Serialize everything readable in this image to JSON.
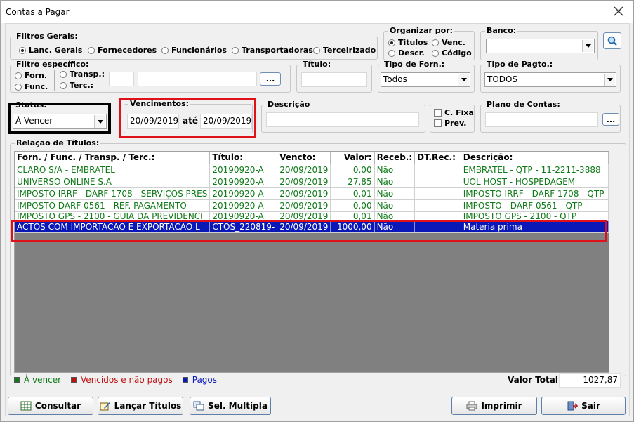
{
  "window": {
    "title": "Contas a Pagar"
  },
  "filtros_gerais": {
    "legend": "Filtros Gerais:",
    "options": [
      "Lanc. Gerais",
      "Fornecedores",
      "Funcionários",
      "Transportadoras",
      "Terceirizado"
    ],
    "selected": "Lanc. Gerais"
  },
  "organizar": {
    "legend": "Organizar por:",
    "options": [
      "Titulos",
      "Venc.",
      "Descr.",
      "Código"
    ],
    "selected": "Titulos"
  },
  "banco": {
    "legend": "Banco:",
    "value": ""
  },
  "filtro_especifico": {
    "legend": "Filtro específico:",
    "options": [
      "Forn.",
      "Func.",
      "Transp.:",
      "Terc.:"
    ],
    "code_value": "",
    "name_value": "",
    "browse_label": "..."
  },
  "titulo": {
    "legend": "Título:",
    "value": ""
  },
  "tipo_forn": {
    "legend": "Tipo de Forn.:",
    "value": "Todos"
  },
  "tipo_pagto": {
    "legend": "Tipo de Pagto.:",
    "value": "TODOS"
  },
  "status": {
    "legend": "Status:",
    "value": "À Vencer"
  },
  "vencimentos": {
    "legend": "Vencimentos:",
    "from": "20/09/2019",
    "sep": "até",
    "to": "20/09/2019"
  },
  "descricao": {
    "legend": "Descrição",
    "value": ""
  },
  "checks": {
    "c_fixa": "C. Fixa",
    "prev": "Prev."
  },
  "plano_contas": {
    "legend": "Plano de Contas:",
    "value": "",
    "browse_label": "..."
  },
  "relacao": {
    "legend": "Relação de Títulos:",
    "columns": [
      "Forn. / Func. / Transp. / Terc.:",
      "Título:",
      "Vencto:",
      "Valor:",
      "Receb.:",
      "DT.Rec.:",
      "Descrição:"
    ],
    "rows": [
      [
        "CLARO S/A - EMBRATEL",
        "20190920-A",
        "20/09/2019",
        "0,00",
        "Não",
        "",
        "EMBRATEL - QTP - 11-2211-3888"
      ],
      [
        "UNIVERSO ONLINE S.A",
        "20190920-A",
        "20/09/2019",
        "27,85",
        "Não",
        "",
        "UOL HOST - HOSPEDAGEM"
      ],
      [
        "IMPOSTO IRRF - DARF 1708 - SERVIÇOS PRES",
        "20190920-A",
        "20/09/2019",
        "0,01",
        "Não",
        "",
        "IMPOSTO IRRF - DARF 1708 - QTP"
      ],
      [
        "IMPOSTO DARF 0561 - REF. PAGAMENTO",
        "20190920-A",
        "20/09/2019",
        "0,00",
        "Não",
        "",
        "IMPOSTO - DARF 0561 - QTP"
      ],
      [
        "IMPOSTO GPS - 2100 - GUIA DA PREVIDENCI",
        "20190920-A",
        "20/09/2019",
        "0,01",
        "Não",
        "",
        "IMPOSTO GPS - 2100 - QTP"
      ],
      [
        "ACTOS COM IMPORTACAO E EXPORTACAO L",
        "CTOS_220819-",
        "20/09/2019",
        "1000,00",
        "Não",
        "",
        "Materia prima"
      ]
    ]
  },
  "legend_items": [
    {
      "label": "À vencer",
      "color": "#0f7a18"
    },
    {
      "label": "Vencidos e não pagos",
      "color": "#c01010"
    },
    {
      "label": "Pagos",
      "color": "#0a18b8"
    }
  ],
  "total": {
    "label": "Valor Total:",
    "value": "1027,87"
  },
  "buttons": {
    "consultar": "Consultar",
    "lancar": "Lançar Títulos",
    "sel_multipla": "Sel. Multipla",
    "imprimir": "Imprimir",
    "sair": "Sair"
  },
  "colors": {
    "accent_blue": "#0a18b8",
    "green_text": "#0f7a18",
    "highlight_red": "#e01018"
  }
}
